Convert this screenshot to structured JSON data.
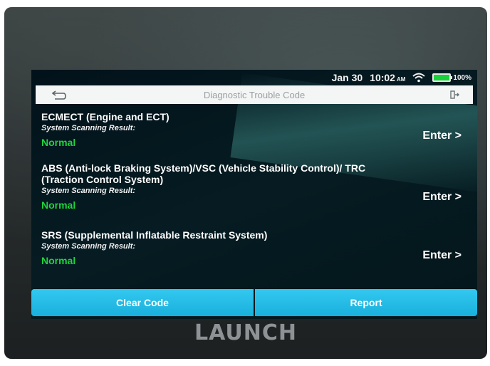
{
  "device": {
    "brand": "LAUNCH"
  },
  "status_bar": {
    "date": "Jan 30",
    "time": "10:02",
    "ampm": "AM",
    "battery": "100%",
    "wifi_icon": "wifi-icon",
    "battery_icon": "battery-icon"
  },
  "header": {
    "title": "Diagnostic Trouble Code",
    "back_icon": "back-arrow-icon",
    "exit_icon": "exit-icon"
  },
  "systems": [
    {
      "name": "ECMECT (Engine and ECT)",
      "result_label": "System Scanning Result:",
      "result": "Normal",
      "action": "Enter >"
    },
    {
      "name": "ABS (Anti-lock Braking System)/VSC (Vehicle Stability Control)/ TRC (Traction Control System)",
      "result_label": "System Scanning Result:",
      "result": "Normal",
      "action": "Enter >"
    },
    {
      "name": "SRS (Supplemental Inflatable Restraint System)",
      "result_label": "System Scanning Result:",
      "result": "Normal",
      "action": "Enter >"
    }
  ],
  "footer": {
    "clear_code": "Clear Code",
    "report": "Report"
  },
  "colors": {
    "accent": "#1fb8e4",
    "status_normal": "#1fd53d",
    "battery_fill": "#18d23a"
  }
}
